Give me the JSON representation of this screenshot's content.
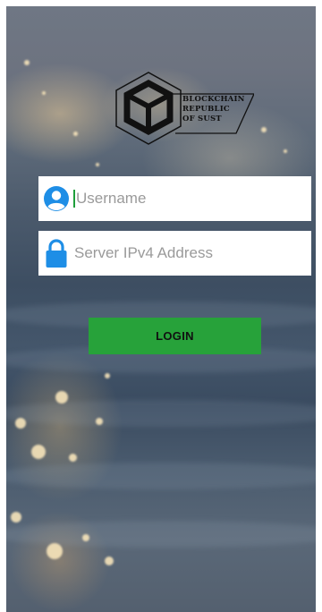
{
  "logo": {
    "lines": [
      "BLOCKCHAIN",
      "REPUBLIC",
      "OF SUST"
    ]
  },
  "form": {
    "username": {
      "value": "",
      "placeholder": "Username",
      "icon": "user-avatar-icon"
    },
    "server": {
      "value": "",
      "placeholder": "Server IPv4 Address",
      "icon": "lock-icon"
    },
    "login_label": "LOGIN"
  },
  "colors": {
    "accent_green": "#27a23a",
    "icon_blue": "#1e8ee6"
  }
}
